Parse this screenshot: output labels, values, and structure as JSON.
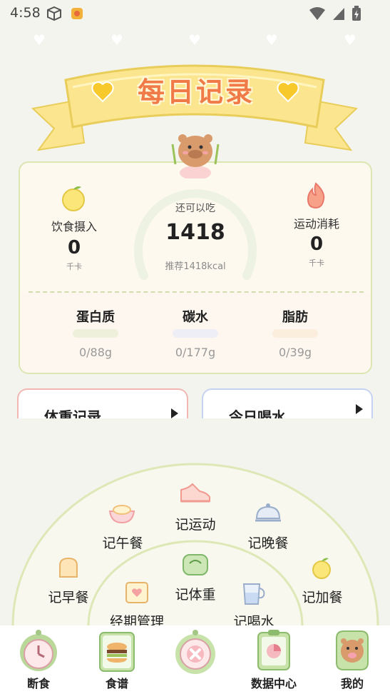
{
  "status_bar": {
    "time": "4:58"
  },
  "header": {
    "title": "每日记录"
  },
  "summary": {
    "intake": {
      "label": "饮食摄入",
      "value": "0",
      "unit": "千卡"
    },
    "remaining": {
      "label": "还可以吃",
      "value": "1418",
      "recommend": "推荐1418kcal"
    },
    "burn": {
      "label": "运动消耗",
      "value": "0",
      "unit": "千卡"
    }
  },
  "macros": [
    {
      "name": "蛋白质",
      "value": "0/88g",
      "color": "#eef0dc"
    },
    {
      "name": "碳水",
      "value": "0/177g",
      "color": "#eeeef7"
    },
    {
      "name": "脂肪",
      "value": "0/39g",
      "color": "#fbeedd"
    }
  ],
  "cards": {
    "weight": {
      "title": "体重记录"
    },
    "water": {
      "title": "今日喝水"
    }
  },
  "quick_menu": {
    "outer": [
      "记运动",
      "记午餐",
      "记晚餐",
      "记早餐",
      "记加餐"
    ],
    "inner": [
      "记体重",
      "经期管理",
      "记喝水"
    ]
  },
  "bottom_nav": {
    "items": [
      "断食",
      "食谱",
      "数据中心",
      "我的"
    ],
    "center_icon": "close-icon"
  },
  "colors": {
    "background": "#f4f4ee",
    "banner": "#fbe68f",
    "title": "#f07a48",
    "card_border": "#dbe6b2",
    "arc": "#e6ecd4"
  }
}
